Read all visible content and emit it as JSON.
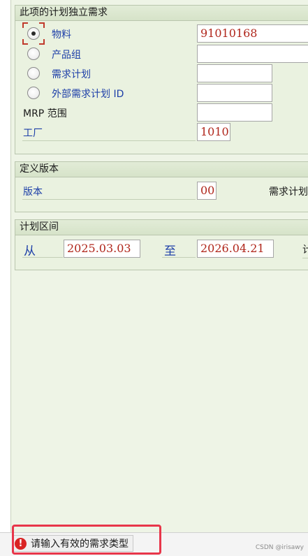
{
  "groups": {
    "independent": {
      "title": "此项的计划独立需求",
      "options": [
        {
          "label": "物料",
          "selected": true,
          "value": "91010168"
        },
        {
          "label": "产品组",
          "selected": false,
          "value": ""
        },
        {
          "label": "需求计划",
          "selected": false,
          "value": ""
        },
        {
          "label": "外部需求计划 ID",
          "selected": false,
          "value": ""
        }
      ],
      "mrp_label": "MRP 范围",
      "mrp_value": "",
      "plant_label": "工厂",
      "plant_value": "1010"
    },
    "version": {
      "title": "定义版本",
      "version_label": "版本",
      "version_value": "00",
      "req_plan_label": "需求计划"
    },
    "interval": {
      "title": "计划区间",
      "from_label": "从",
      "from_value": "2025.03.03",
      "to_label": "至",
      "to_value": "2026.04.21",
      "trailing_label": "计"
    }
  },
  "status": {
    "icon": "error-icon",
    "icon_glyph": "!",
    "message": "请输入有效的需求类型",
    "highlight_color": "#e8364a"
  },
  "watermark": "CSDN @irisawy"
}
